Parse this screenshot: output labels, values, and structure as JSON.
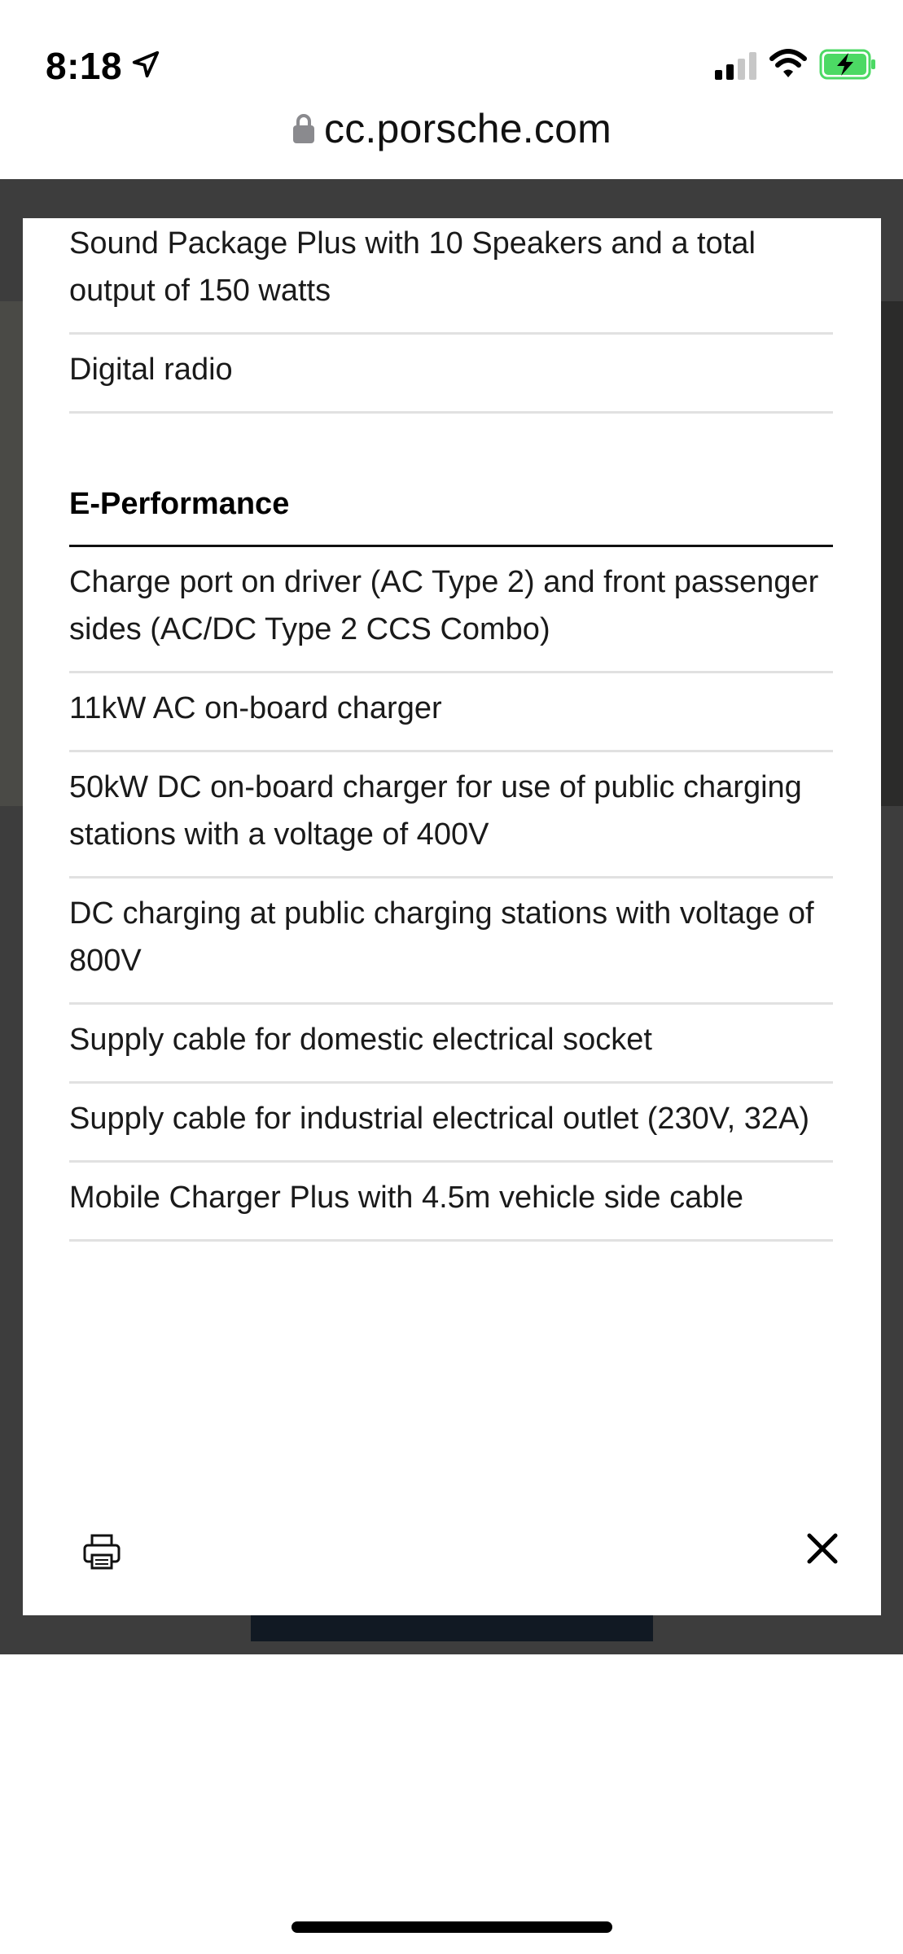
{
  "status_bar": {
    "time": "8:18",
    "icons": [
      "location-arrow-icon",
      "cellular-signal-icon",
      "wifi-icon",
      "battery-charging-icon"
    ]
  },
  "browser": {
    "url": "cc.porsche.com",
    "lock_icon": "lock-icon"
  },
  "modal": {
    "top_items": [
      "Sound Package Plus with 10 Speakers and a total output of 150 watts",
      "Digital radio"
    ],
    "section_heading": "E-Performance",
    "section_items": [
      "Charge port on driver (AC Type 2) and front passenger sides (AC/DC Type 2 CCS Combo)",
      "11kW AC on-board charger",
      "50kW DC on-board charger for use of public charging stations with a voltage of 400V",
      "DC charging at public charging stations with voltage of 800V",
      "Supply cable for domestic electrical socket",
      "Supply cable for industrial electrical outlet (230V, 32A)",
      "Mobile Charger Plus with 4.5m vehicle side cable"
    ],
    "footer": {
      "print_icon": "print-icon",
      "close_icon": "close-icon"
    }
  },
  "colors": {
    "backdrop": "#3d3d3d",
    "divider": "#e1e1e1",
    "heading_rule": "#111111",
    "battery_green": "#4cd964"
  }
}
